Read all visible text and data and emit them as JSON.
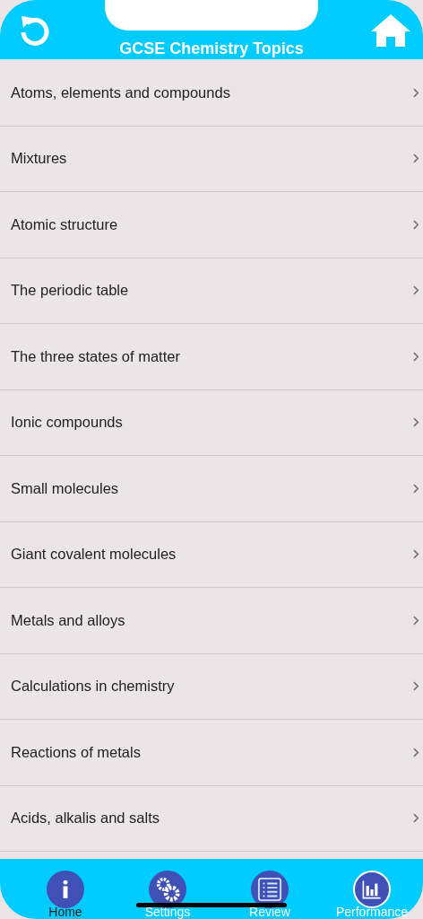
{
  "header": {
    "title": "GCSE Chemistry Topics"
  },
  "topics": [
    {
      "label": "Atoms, elements and compounds"
    },
    {
      "label": "Mixtures"
    },
    {
      "label": "Atomic structure"
    },
    {
      "label": "The periodic table"
    },
    {
      "label": "The three states of matter"
    },
    {
      "label": "Ionic compounds"
    },
    {
      "label": "Small molecules"
    },
    {
      "label": "Giant covalent molecules"
    },
    {
      "label": "Metals and alloys"
    },
    {
      "label": "Calculations in chemistry"
    },
    {
      "label": "Reactions of metals"
    },
    {
      "label": "Acids, alkalis and salts"
    }
  ],
  "tab_bar": [
    {
      "label": "Home",
      "kind": "info",
      "selected": false
    },
    {
      "label": "Settings",
      "kind": "gears",
      "selected": false
    },
    {
      "label": "Review",
      "kind": "list",
      "selected": false
    },
    {
      "label": "Performance",
      "kind": "chart",
      "selected": true
    }
  ]
}
